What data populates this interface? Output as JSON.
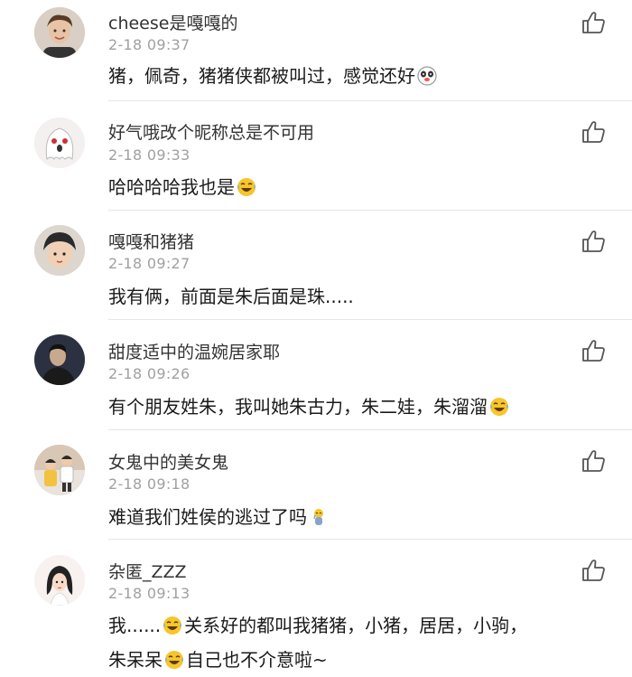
{
  "comments": [
    {
      "username": "cheese是嘎嘎的",
      "time": "2-18 09:37",
      "line1a": "猪，佩奇，猪猪侠都被叫过，感觉还好",
      "emoji1": "panda-face-emoji",
      "avatar": "avatar-young-man"
    },
    {
      "username": "好气哦改个昵称总是不可用",
      "time": "2-18 09:33",
      "line1a": "哈哈哈哈我也是",
      "emoji1": "laughing-tears-emoji",
      "avatar": "avatar-cartoon-ghost"
    },
    {
      "username": "嘎嘎和猪猪",
      "time": "2-18 09:27",
      "line1a": "我有俩，前面是朱后面是珠.....",
      "avatar": "avatar-child-in-hat"
    },
    {
      "username": "甜度适中的温婉居家耶",
      "time": "2-18 09:26",
      "line1a": "有个朋友姓朱，我叫她朱古力，朱二娃，朱溜溜",
      "emoji1": "laughing-tears-emoji",
      "avatar": "avatar-man-dark"
    },
    {
      "username": "女鬼中的美女鬼",
      "time": "2-18 09:18",
      "line1a": "难道我们姓侯的逃过了吗",
      "emoji1": "crying-figure-emoji",
      "avatar": "avatar-two-kids"
    },
    {
      "username": "杂匿_ZZZ",
      "time": "2-18 09:13",
      "line1a": "我......",
      "line1b": "关系好的都叫我猪猪，小猪，居居，小驹，",
      "line2a": "朱呆呆",
      "line2b": "自己也不介意啦~",
      "emoji1": "laughing-tears-emoji",
      "emoji2": "laughing-tears-emoji",
      "avatar": "avatar-girl-cartoon"
    }
  ],
  "like_icon": "thumbs-up-icon"
}
